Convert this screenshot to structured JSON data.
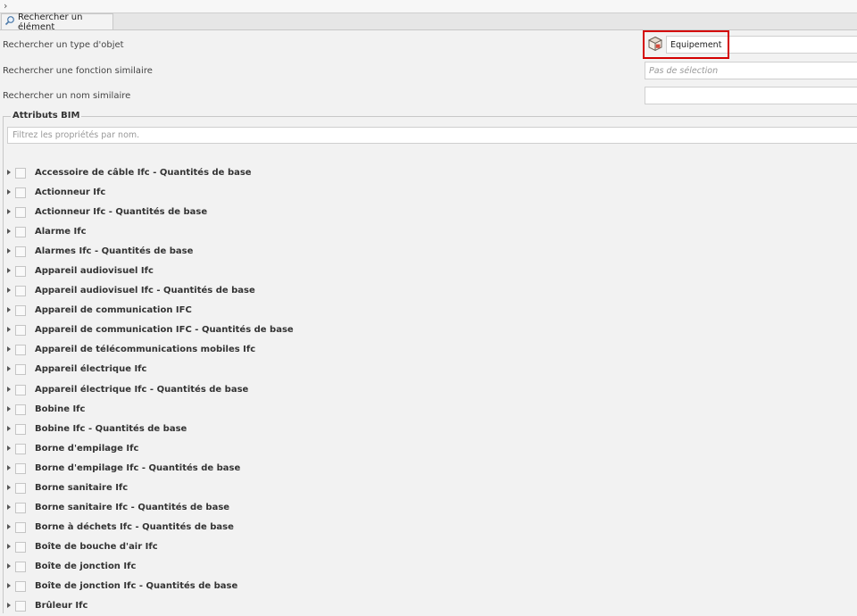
{
  "tab": {
    "label": "Rechercher un élément",
    "icon": "search-icon"
  },
  "form": {
    "object_type": {
      "label": "Rechercher un type d'objet",
      "value": "Equipement",
      "icon": "equipment-cube-icon"
    },
    "similar_function": {
      "label": "Rechercher une fonction similaire",
      "placeholder": "Pas de sélection"
    },
    "similar_name": {
      "label": "Rechercher un nom similaire",
      "value": ""
    }
  },
  "bim": {
    "group_title": "Attributs BIM",
    "filter_placeholder": "Filtrez les propriétés par nom.",
    "items": [
      "Accessoire de câble Ifc - Quantités de base",
      "Actionneur Ifc",
      "Actionneur Ifc - Quantités de base",
      "Alarme Ifc",
      "Alarmes Ifc - Quantités de base",
      "Appareil audiovisuel Ifc",
      "Appareil audiovisuel Ifc - Quantités de base",
      "Appareil de communication IFC",
      "Appareil de communication IFC - Quantités de base",
      "Appareil de télécommunications mobiles Ifc",
      "Appareil électrique Ifc",
      "Appareil électrique Ifc - Quantités de base",
      "Bobine Ifc",
      "Bobine Ifc - Quantités de base",
      "Borne d'empilage Ifc",
      "Borne d'empilage Ifc - Quantités de base",
      "Borne sanitaire Ifc",
      "Borne sanitaire Ifc - Quantités de base",
      "Borne à déchets Ifc - Quantités de base",
      "Boîte de bouche d'air Ifc",
      "Boîte de jonction Ifc",
      "Boîte de jonction Ifc - Quantités de base",
      "Brûleur Ifc"
    ]
  },
  "colors": {
    "highlight": "#d40000",
    "background": "#f2f2f2"
  }
}
